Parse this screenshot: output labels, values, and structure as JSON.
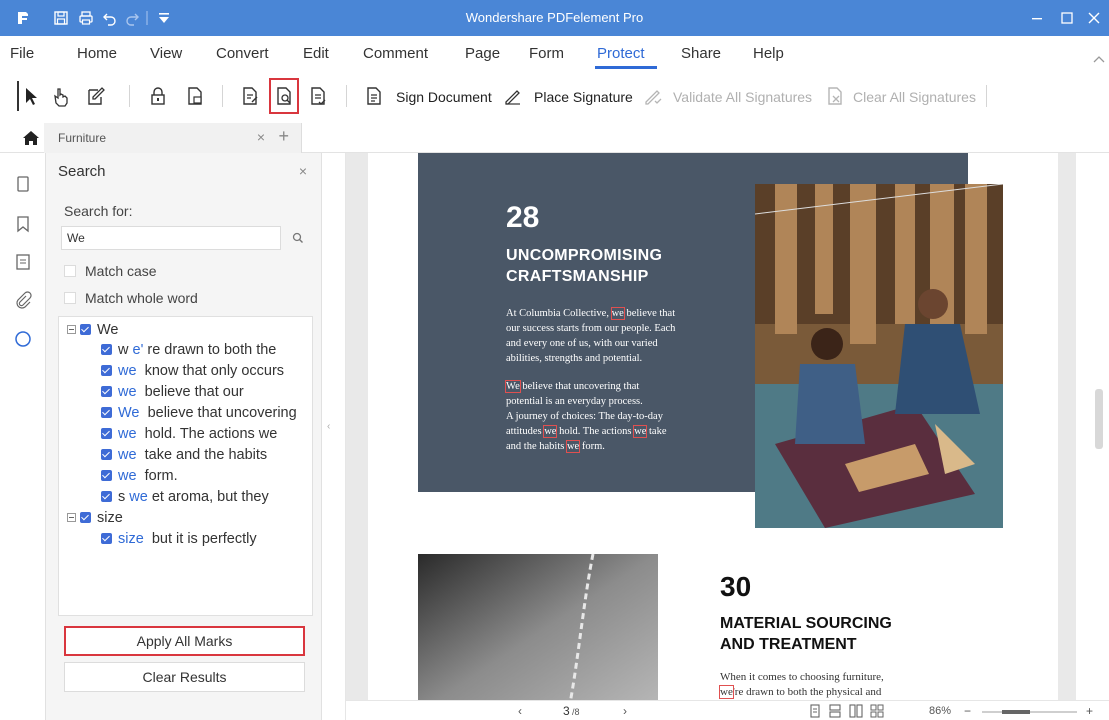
{
  "window": {
    "title": "Wondershare PDFelement Pro"
  },
  "menu": {
    "items": [
      "File",
      "Home",
      "View",
      "Convert",
      "Edit",
      "Comment",
      "Page",
      "Form",
      "Protect",
      "Share",
      "Help"
    ],
    "active": "Protect"
  },
  "toolbar": {
    "sign_document": "Sign Document",
    "place_signature": "Place Signature",
    "validate_all": "Validate All Signatures",
    "clear_all": "Clear All Signatures"
  },
  "tab": {
    "title": "Furniture",
    "close": "×",
    "add": "+"
  },
  "search_panel": {
    "title": "Search",
    "close": "×",
    "search_for_label": "Search for:",
    "query": "We",
    "match_case": "Match case",
    "match_whole_word": "Match whole word",
    "groups": [
      {
        "term": "We",
        "results": [
          {
            "pre": "w",
            "kw": "e'",
            "post": "re drawn to both the"
          },
          {
            "pre": "",
            "kw": "we",
            "post": "know that only occurs"
          },
          {
            "pre": "",
            "kw": "we",
            "post": "believe that our"
          },
          {
            "pre": "",
            "kw": "We",
            "post": "believe that uncovering"
          },
          {
            "pre": "",
            "kw": "we",
            "post": "hold. The actions we"
          },
          {
            "pre": "",
            "kw": "we",
            "post": "take and the habits"
          },
          {
            "pre": "",
            "kw": "we",
            "post": "form."
          },
          {
            "pre": "s",
            "kw": "we",
            "post": "et aroma, but they"
          }
        ]
      },
      {
        "term": "size",
        "results": [
          {
            "pre": "",
            "kw": "size",
            "post": "but it is perfectly"
          }
        ]
      }
    ],
    "apply_label": "Apply All Marks",
    "clear_label": "Clear Results"
  },
  "document": {
    "page28": {
      "number": "28",
      "heading_line1": "UNCOMPROMISING",
      "heading_line2": "CRAFTSMANSHIP",
      "para1_line1_a": "At Columbia Collective, ",
      "para1_line1_b": "we",
      "para1_line1_c": " believe that",
      "para1_line2": "our success starts from our people. Each",
      "para1_line3": "and every one of us, with our varied",
      "para1_line4": "abilities, strengths and potential.",
      "para2_line1_a": "We",
      "para2_line1_b": " believe that uncovering that",
      "para2_line2": "potential is an everyday process.",
      "para2_line3": "A journey of choices: The day-to-day",
      "para2_line4_a": "attitudes ",
      "para2_line4_b": "we",
      "para2_line4_c": " hold. The actions ",
      "para2_line4_d": "we",
      "para2_line4_e": " take",
      "para2_line5_a": "and the habits ",
      "para2_line5_b": "we",
      "para2_line5_c": " form."
    },
    "page30": {
      "number": "30",
      "heading_line1": "MATERIAL SOURCING",
      "heading_line2": "AND TREATMENT",
      "para_line1": "When it comes to choosing furniture,",
      "para_line2_a": "we",
      "para_line2_b": "'re drawn to both the physical and"
    }
  },
  "status": {
    "page_current": "3",
    "page_total": "/8",
    "zoom": "86%",
    "prev": "‹",
    "next": "›",
    "zoom_out": "−",
    "zoom_in": "+"
  },
  "colors": {
    "titlebar": "#4a86d6",
    "accent": "#2f6ad6",
    "highlight_border": "#d9363e",
    "navy_block": "#4a5767"
  }
}
